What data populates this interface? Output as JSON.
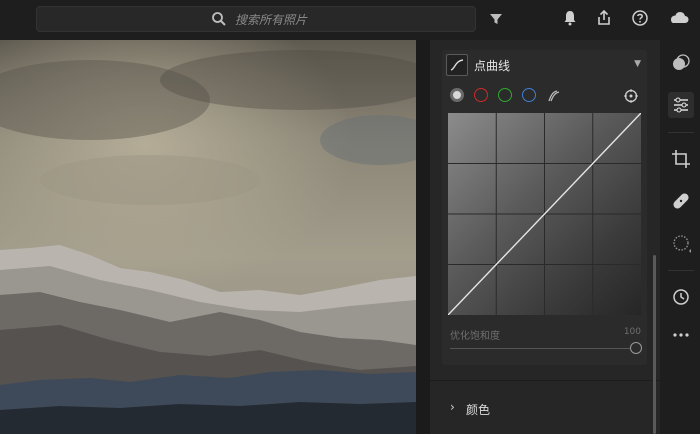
{
  "search": {
    "placeholder": "搜索所有照片",
    "icon": "search-icon"
  },
  "toolbar": {
    "icons": [
      "filter-icon",
      "bell-icon",
      "share-icon",
      "help-icon",
      "cloud-icon"
    ]
  },
  "panel": {
    "curve": {
      "title": "点曲线",
      "channels": [
        "rgb",
        "red",
        "green",
        "blue",
        "all"
      ],
      "saturation_label": "优化饱和度",
      "saturation_value": "100"
    },
    "color_section": {
      "label": "颜色"
    }
  },
  "strip": {
    "tools": [
      "mask-icon",
      "adjust-icon",
      "crop-icon",
      "heal-icon",
      "brush-icon",
      "history-icon",
      "more-icon"
    ],
    "active": "adjust-icon"
  },
  "colors": {
    "red": "#cc2b2b",
    "green": "#2fa82f",
    "blue": "#3f7fd4"
  }
}
